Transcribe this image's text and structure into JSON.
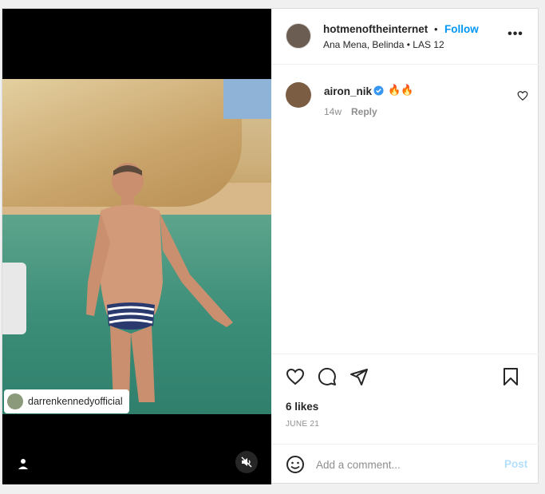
{
  "post": {
    "media": {
      "tag_username": "darrenkennedyofficial"
    },
    "header": {
      "username": "hotmenoftheinternet",
      "separator": "•",
      "follow_label": "Follow",
      "subtitle": "Ana Mena, Belinda • LAS 12",
      "more_label": "•••"
    },
    "comments": [
      {
        "username": "airon_nik",
        "text": "🔥🔥",
        "age": "14w",
        "reply_label": "Reply",
        "verified": true
      }
    ],
    "likes_text": "6 likes",
    "date_text": "JUNE 21",
    "compose": {
      "placeholder": "Add a comment...",
      "post_label": "Post"
    }
  },
  "colors": {
    "accent": "#0095f6",
    "post_disabled": "#b2dffc",
    "verified": "#3897f0"
  },
  "icons": [
    "user-icon",
    "mute-icon",
    "more-icon",
    "verified-icon",
    "heart-icon",
    "comment-icon",
    "share-icon",
    "bookmark-icon",
    "emoji-icon"
  ]
}
